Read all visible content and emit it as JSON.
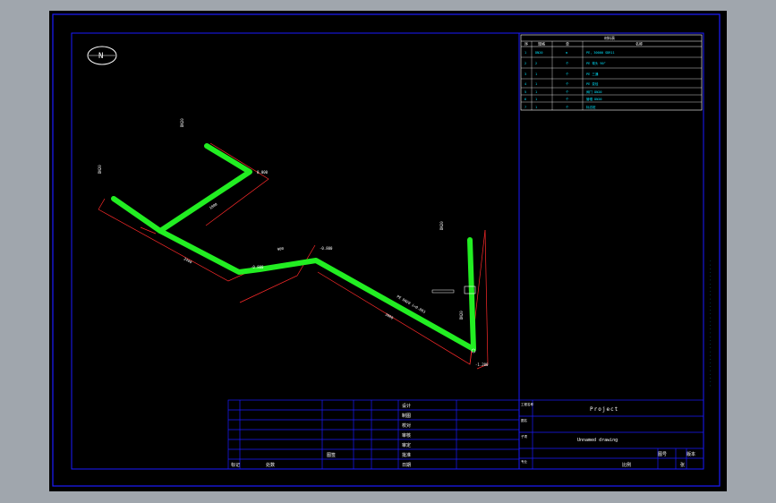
{
  "north_label": "N",
  "table": {
    "title": "材料表",
    "headers": [
      "序",
      "规格",
      "单",
      "名称"
    ],
    "rows": [
      [
        "1",
        "DN20",
        "m",
        "PE, 30000 SDR11"
      ],
      [
        "2",
        "2",
        "个",
        "PE 弯头 90°"
      ],
      [
        "3",
        "1",
        "个",
        "PE 三通"
      ],
      [
        "4",
        "1",
        "个",
        "PE 变径"
      ],
      [
        "5",
        "1",
        "个",
        "阀门 DN20"
      ],
      [
        "6",
        "1",
        "个",
        "管帽 DN20"
      ],
      [
        "7",
        "1",
        "个",
        "标志桩"
      ]
    ]
  },
  "title_block": {
    "project": "Project",
    "drawing_name": "Unnamed drawing",
    "scale_label": "比例",
    "sheet_label": "张",
    "left_labels": [
      "设计",
      "制图",
      "校对",
      "审核",
      "审定",
      "批准",
      "日期"
    ],
    "mid_labels": [
      "图号",
      "版本"
    ],
    "col_labels": [
      "工程名称",
      "图名",
      "子项",
      "专业",
      "阶段",
      "设计号",
      "图 号"
    ],
    "stamp": "图签",
    "row_labels": [
      "标记",
      "处数"
    ]
  },
  "pipe_labels": {
    "left_end": "DN20",
    "top_end": "DN20",
    "right_top": "DN20",
    "elevation_1": "-0.800",
    "elevation_2": "-0.800",
    "elevation_3": "-1.200",
    "elevation_4": "0.000",
    "dimension_1": "2400",
    "dimension_2": "1800",
    "dimension_3": "3000",
    "dimension_4": "900",
    "main_run": "PE DN20 i=0.003",
    "riser": "DN20"
  },
  "colors": {
    "background": "#000000",
    "frame": "#1a1aff",
    "pipe": "#22ee22",
    "dimension": "#ff2a2a",
    "text": "#ffffff",
    "table_text": "#00e5ff",
    "outside": "#a0a6ad"
  }
}
